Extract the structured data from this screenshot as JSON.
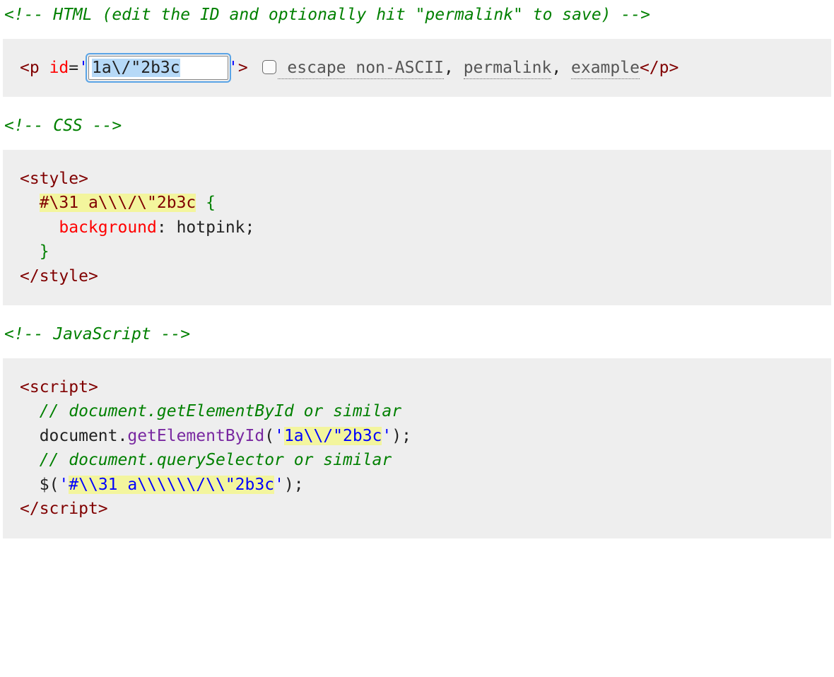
{
  "html_section": {
    "comment": "<!-- HTML (edit the ID and optionally hit \"permalink\" to save) -->",
    "p_open_1": "<",
    "p_open_tag": "p",
    "p_open_sp": " ",
    "attr_id": "id",
    "eq": "=",
    "q1": "'",
    "input_value": "1a\\/\"2b3c",
    "q2": "'",
    "gt": ">",
    "checkbox_checked": false,
    "checkbox_label": " escape non-ASCII",
    "sep1": ", ",
    "link_permalink": "permalink",
    "sep2": ", ",
    "link_example": "example",
    "p_close_1": "</",
    "p_close_tag": "p",
    "p_close_2": ">"
  },
  "css_section": {
    "comment": "<!-- CSS -->",
    "style_open_1": "<",
    "style_open_tag": "style",
    "style_open_2": ">",
    "indent1": "  ",
    "selector": "#\\31 a\\\\\\/\\\"2b3c",
    "space": " ",
    "brace_open": "{",
    "indent2": "    ",
    "prop": "background",
    "colon": ": ",
    "value": "hotpink",
    "semi": ";",
    "brace_close_indent": "  ",
    "brace_close": "}",
    "style_close_1": "</",
    "style_close_tag": "style",
    "style_close_2": ">"
  },
  "js_section": {
    "comment": "<!-- JavaScript -->",
    "script_open_1": "<",
    "script_open_tag": "script",
    "script_open_2": ">",
    "indent": "  ",
    "c1": "// document.getElementById or similar",
    "doc": "document",
    "dot": ".",
    "gEBI": "getElementById",
    "paren_open": "(",
    "q": "'",
    "gEBI_arg": "1a\\\\/\"2b3c",
    "paren_close": ")",
    "semi": ";",
    "c2": "// document.querySelector or similar",
    "jq": "$",
    "qs_arg": "#\\\\31 a\\\\\\\\\\\\/\\\\\"2b3c",
    "script_close_1": "</",
    "script_close_tag": "script",
    "script_close_2": ">"
  }
}
